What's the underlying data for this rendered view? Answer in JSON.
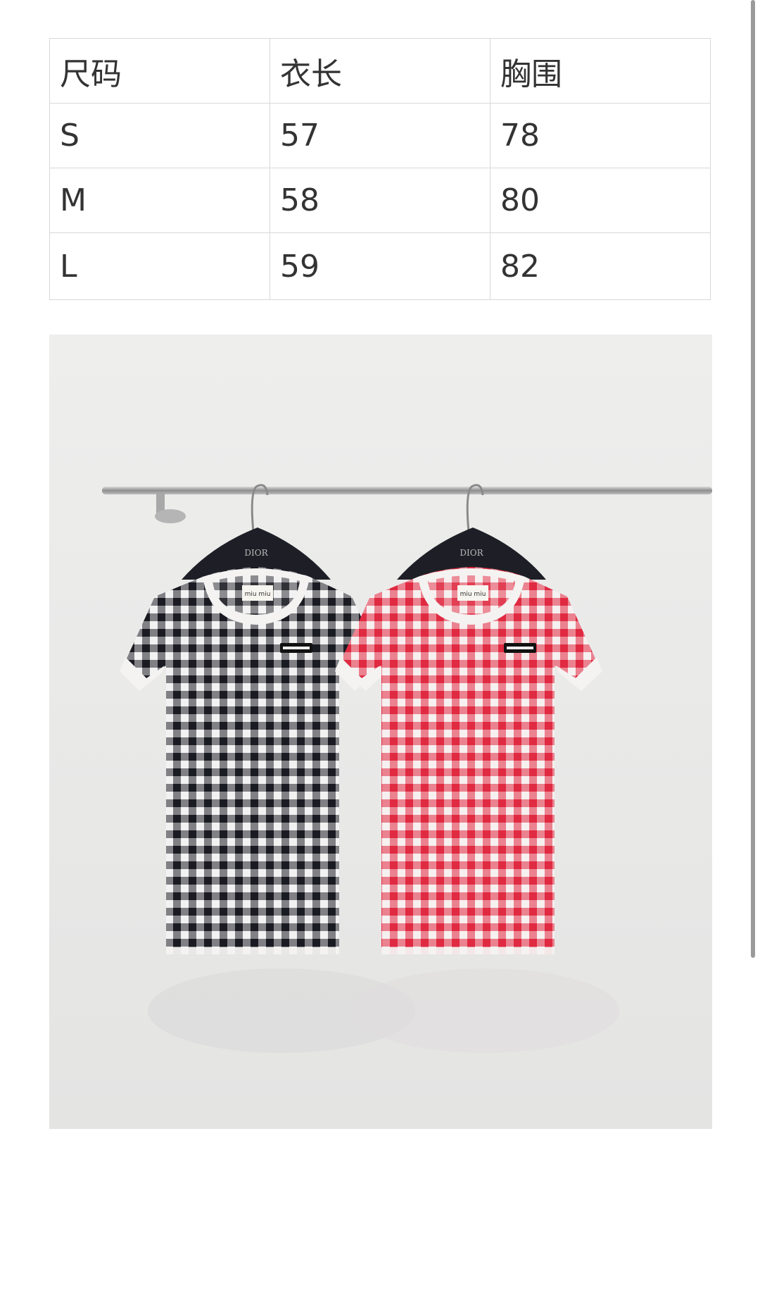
{
  "size_table": {
    "headers": [
      "尺码",
      "衣长",
      "胸围"
    ],
    "rows": [
      [
        "S",
        "57",
        "78"
      ],
      [
        "M",
        "58",
        "80"
      ],
      [
        "L",
        "59",
        "82"
      ]
    ]
  },
  "photo": {
    "hanger_brand": "DIOR",
    "label_text": "miu miu",
    "colors": {
      "left_shirt": "#23232b",
      "right_shirt": "#e5384e",
      "trim": "#f4f3f1",
      "wall": "#e9e9e8"
    }
  }
}
